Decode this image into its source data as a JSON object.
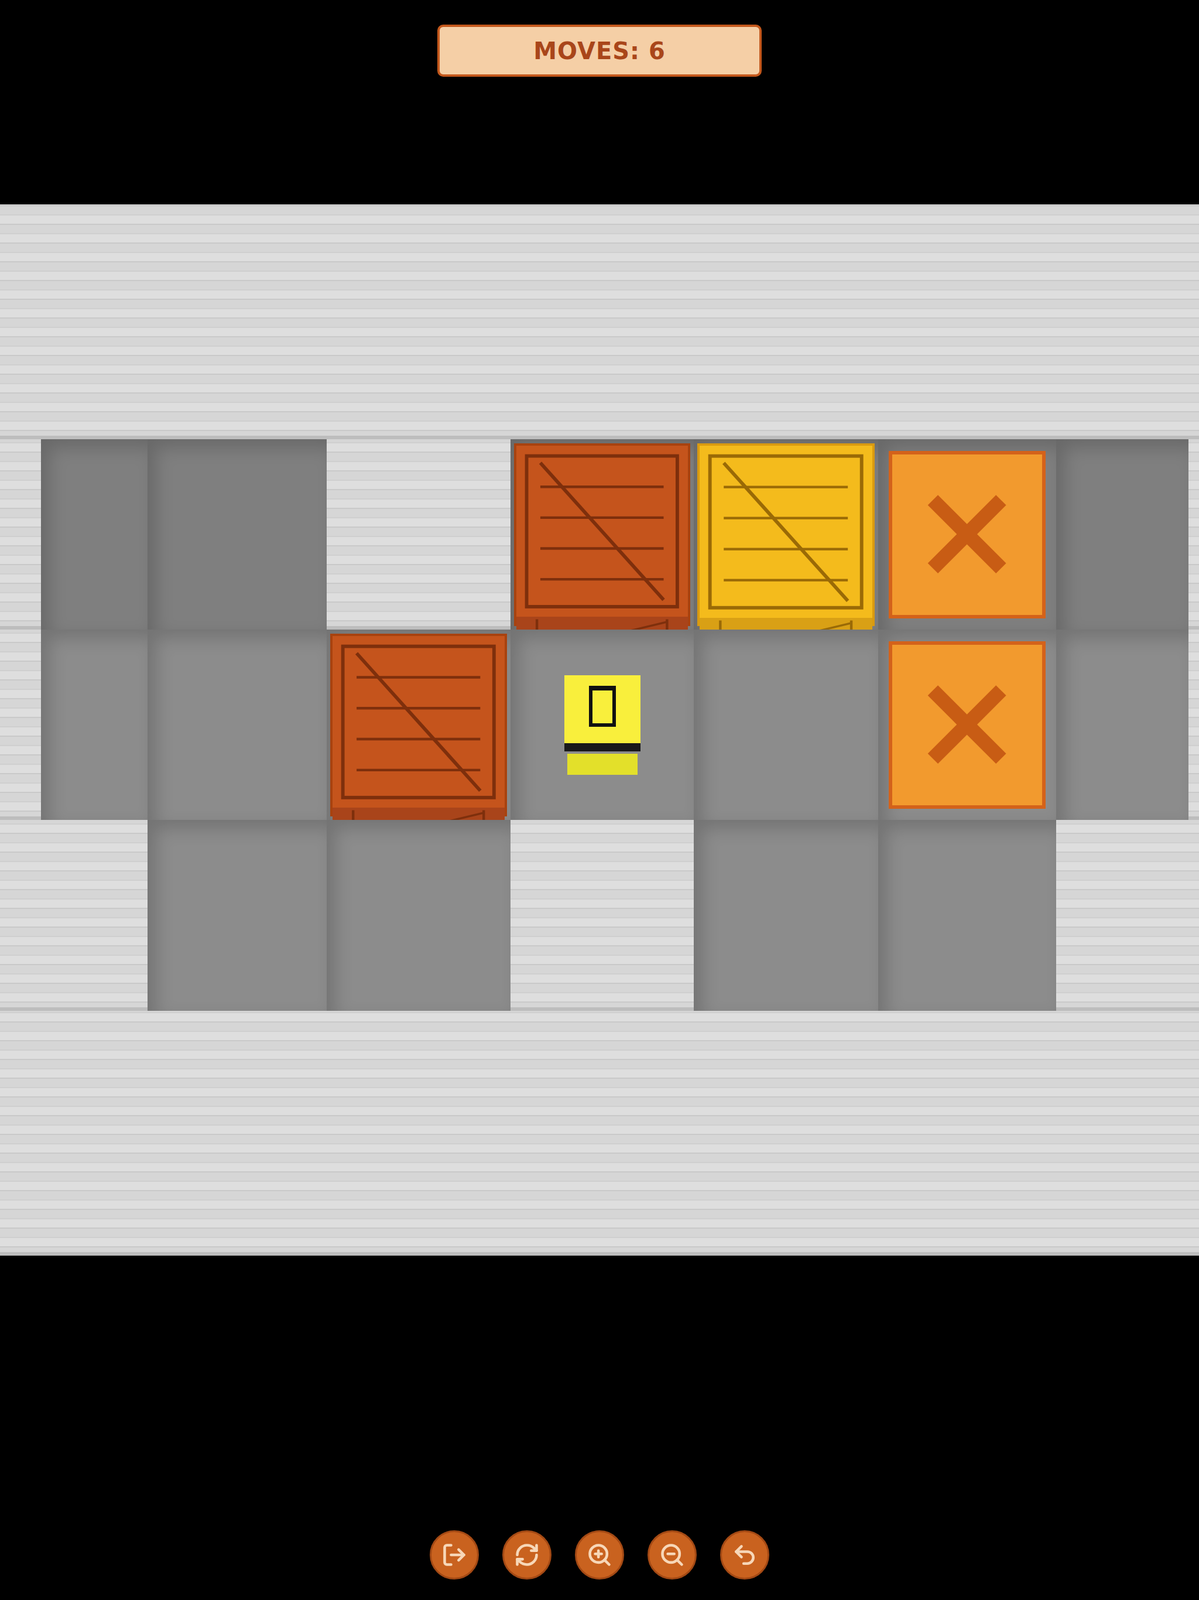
{
  "moves": {
    "label": "MOVES: 6"
  },
  "level": [
    "#########",
    "#  #$*. #",
    "#  $@ . #",
    "##  #  ##",
    "#########"
  ],
  "legend": {
    "#": "wall",
    " ": "floor",
    ".": "target",
    "$": "crate",
    "*": "crate on target",
    "@": "player"
  }
}
